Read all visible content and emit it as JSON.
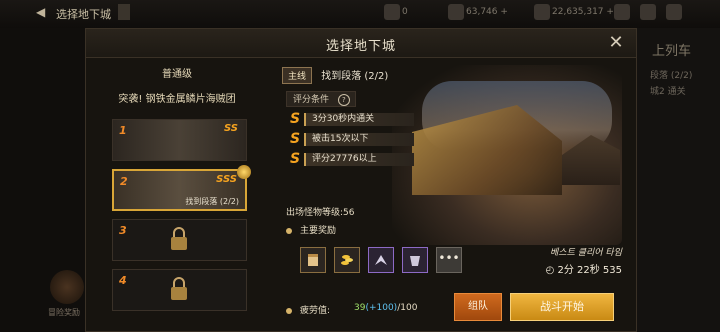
{
  "background": {
    "top_title": "选择地下城",
    "resource_1": "0",
    "resource_2": "63,746 +",
    "resource_3": "22,635,317 +",
    "right_title": "上列车",
    "right_line_1": "段落 (2/2)",
    "right_line_2": "城2 通关",
    "left_label": "冒险奖励"
  },
  "modal": {
    "title": "选择地下城",
    "close_label": "✕"
  },
  "left_panel": {
    "difficulty": "普通级",
    "dungeon_name": "突袭! 钢铁金属鳞片海贼团",
    "stages": [
      {
        "num": "1",
        "rank": "SS",
        "caption": ""
      },
      {
        "num": "2",
        "rank": "SSS",
        "caption": "找到段落 (2/2)"
      },
      {
        "num": "3",
        "rank": "",
        "caption": ""
      },
      {
        "num": "4",
        "rank": "",
        "caption": ""
      }
    ]
  },
  "mission": {
    "tag": "主线",
    "text": "找到段落 (2/2)"
  },
  "criteria": {
    "heading": "评分条件",
    "help_icon": "?",
    "items": [
      {
        "rank": "S",
        "text": "3分30秒内通关"
      },
      {
        "rank": "S",
        "text": "被击15次以下"
      },
      {
        "rank": "S",
        "text": "评分27776以上"
      }
    ]
  },
  "monster_level": "出场怪物等级:56",
  "rewards": {
    "heading": "主要奖励",
    "items": [
      {
        "icon": "scroll-icon",
        "tier": "gold"
      },
      {
        "icon": "gold-coins-icon",
        "tier": "gold"
      },
      {
        "icon": "wings-icon",
        "tier": "purple"
      },
      {
        "icon": "armor-icon",
        "tier": "purple"
      }
    ],
    "more_label": "•••"
  },
  "best_clear": {
    "label": "베스트 클리어 타임",
    "time": "2分 22秒 535"
  },
  "fatigue": {
    "label": "疲劳值:",
    "current": "39",
    "bonus": "(+100)",
    "max": "/100"
  },
  "buttons": {
    "party": "组队",
    "start": "战斗开始"
  },
  "colors": {
    "accent_gold": "#f5a320",
    "start_button": "#f0b640",
    "party_button": "#d06a1e"
  }
}
